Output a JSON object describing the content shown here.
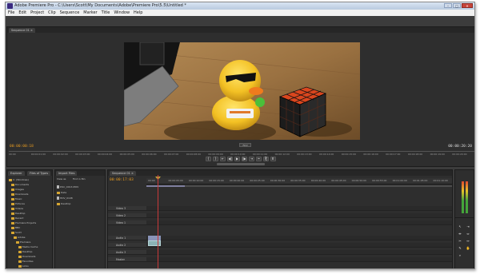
{
  "window": {
    "title": "Adobe Premiere Pro - C:\\Users\\Scott\\My Documents\\Adobe\\Premiere Pro\\5.5\\Untitled *",
    "min": "–",
    "max": "□",
    "close": "✕"
  },
  "menubar": [
    "File",
    "Edit",
    "Project",
    "Clip",
    "Sequence",
    "Marker",
    "Title",
    "Window",
    "Help"
  ],
  "monitor": {
    "tab_label": "Sequence 01 ×",
    "timecode_left": "00:00:00:18",
    "timecode_right": "00:00:20:20",
    "fit_label": "Fit ▾",
    "ruler_ticks": [
      "00:00",
      "00:00:01:00",
      "00:00:02:00",
      "00:00:03:00",
      "00:00:04:00",
      "00:00:05:00",
      "00:00:06:00",
      "00:00:07:00",
      "00:00:08:00",
      "00:00:09:00",
      "00:00:10:00",
      "00:00:11:00",
      "00:00:12:00",
      "00:00:13:00",
      "00:00:14:00",
      "00:00:15:00",
      "00:00:16:00",
      "00:00:17:00",
      "00:00:18:00",
      "00:00:19:00",
      "00:00:20:00"
    ],
    "transport": [
      "{",
      "}",
      "⇤",
      "◀|",
      "▶",
      "|▶",
      "⇥",
      "✂",
      "⎘",
      "⌷"
    ]
  },
  "project": {
    "tabs": [
      "Explorer",
      "Files of Types",
      "Import Files"
    ],
    "tree": [
      "C: (Windows)",
      "Documents",
      "Images",
      "Downloads",
      "Music",
      "Pictures",
      "Videos",
      "Desktop",
      "Recent",
      "Premiere Projects",
      "BBC",
      "Scott",
      "Adobe",
      "Premiere",
      "Media Cache",
      "Desktop",
      "Downloads",
      "Favorites",
      "Links"
    ]
  },
  "bin": {
    "tabs": [
      "View as",
      "Find in Bin"
    ],
    "items": [
      "DSC_0013.MOV",
      "Data",
      "HDV_0108",
      "Desktop"
    ]
  },
  "timeline": {
    "tab_label": "Sequence 01 ×",
    "timecode": "00:00:17:03",
    "ruler_ticks": [
      "00:00",
      "00:00:05:00",
      "00:00:10:00",
      "00:00:15:00",
      "00:00:20:00",
      "00:00:25:00",
      "00:00:30:00",
      "00:00:35:00",
      "00:00:40:00",
      "00:00:45:00",
      "00:00:50:00",
      "00:00:55:00",
      "00:01:00:00",
      "00:01:05:00",
      "00:01:10:00"
    ],
    "tracks": [
      {
        "label": "Video 3"
      },
      {
        "label": "Video 2"
      },
      {
        "label": "Video 1"
      },
      {
        "label": "Audio 1"
      },
      {
        "label": "Audio 2"
      },
      {
        "label": "Audio 3"
      },
      {
        "label": "Master"
      }
    ],
    "work_area_fraction": 0.126
  },
  "colors": {
    "timecode": "#e79b20",
    "playhead": "#c83a3a",
    "clip_video": "#8a94b8",
    "clip_audio": "#8bb2b5"
  }
}
